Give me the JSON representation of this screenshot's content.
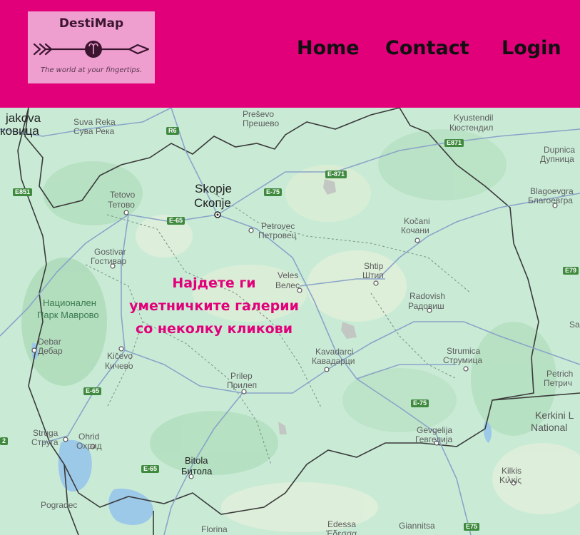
{
  "header": {
    "background_color": "#e2007a",
    "logo": {
      "title": "DestiMap",
      "tagline": "The world at your fingertips.",
      "background_color": "#ef9fcf",
      "icon": "arrow-logo-icon"
    },
    "nav": {
      "home_label": "Home",
      "contact_label": "Contact",
      "login_label": "Login"
    }
  },
  "map": {
    "overlay": {
      "line1": "Најдете ги",
      "line2": "уметничките галерии",
      "line3": "со неколку кликови",
      "color": "#e2007a"
    },
    "places": {
      "djakovica": "jakova",
      "djakovica_cyr": "ковица",
      "suva_reka": "Suva Reka",
      "suva_reka_cyr": "Сува Река",
      "presevo": "Preševo",
      "presevo_cyr": "Прешево",
      "kyustendil": "Kyustendil",
      "kyustendil_cyr": "Кюстендил",
      "dupnica": "Dupnica",
      "dupnica_cyr": "Дупница",
      "skopje": "Skopje",
      "skopje_cyr": "Скопје",
      "tetovo": "Tetovo",
      "tetovo_cyr": "Тетово",
      "blagoevgrad": "Blagoevgra",
      "blagoevgrad_cyr": "Благоевгра",
      "petrovec": "Petrovec",
      "petrovec_cyr": "Петровец",
      "kocani": "Kočani",
      "kocani_cyr": "Кочани",
      "gostivar": "Gostivar",
      "gostivar_cyr": "Гостивар",
      "shtip": "Shtip",
      "shtip_cyr": "Штип",
      "veles": "Veles",
      "veles_cyr": "Велес",
      "park": "Национален",
      "park2": "Парк Маврово",
      "radovish": "Radovish",
      "radovish_cyr": "Радовиш",
      "sa": "Sa",
      "debar": "Debar",
      "debar_cyr": "Дебар",
      "kavadarci": "Kavadarci",
      "kavadarci_cyr": "Кавадарци",
      "kicevo": "Kičevo",
      "kicevo_cyr": "Кичево",
      "strumica": "Strumica",
      "strumica_cyr": "Струмица",
      "prilep": "Prilep",
      "prilep_cyr": "Прилеп",
      "petrich": "Petrich",
      "petrich_cyr": "Петрич",
      "kerkini": "Kerkini L",
      "kerkini2": "National",
      "struga": "Struga",
      "struga_cyr": "Струга",
      "ohrid": "Ohrid",
      "ohrid_cyr": "Охрид",
      "gevgelija": "Gevgelija",
      "gevgelija_cyr": "Гевгелија",
      "bitola": "Bitola",
      "bitola_cyr": "Битола",
      "kilkis": "Kilkis",
      "kilkis_cyr": "Κιλκίς",
      "pogradec": "Pogradec",
      "edessa": "Edessa",
      "edessa_cyr": "Έδεσσα",
      "giannitsa": "Giannitsa",
      "florina": "Florina"
    },
    "roads": {
      "r6": "R6",
      "e871a": "E871",
      "e871b": "E-871",
      "e851": "E851",
      "e75a": "E-75",
      "e65a": "E-65",
      "e79": "E79",
      "e65b": "E-65",
      "e75b": "E-75",
      "e65c": "E-65",
      "e75c": "E75",
      "r2": "2"
    }
  }
}
